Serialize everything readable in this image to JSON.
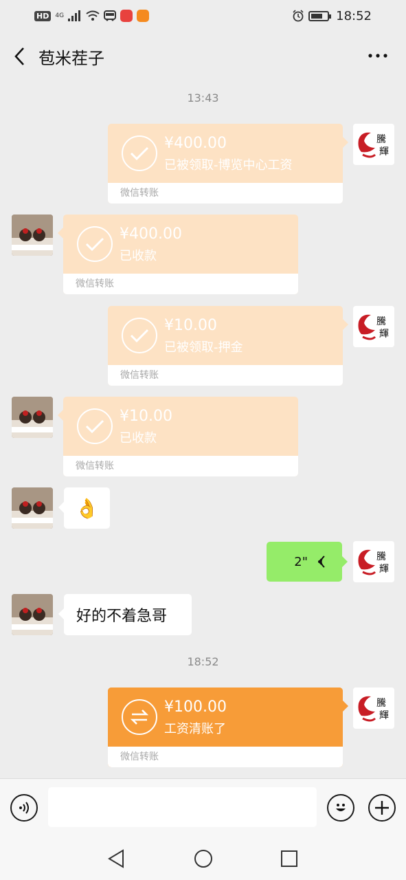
{
  "status_bar": {
    "hd": "HD",
    "network": "4G",
    "time": "18:52"
  },
  "header": {
    "back_icon": "chevron-left-icon",
    "title": "苞米茬子",
    "more_icon": "more-icon"
  },
  "self_avatar_text": [
    "騰",
    "輝"
  ],
  "messages": [
    {
      "type": "time",
      "text": "13:43"
    },
    {
      "type": "transfer",
      "side": "self",
      "amount": "¥400.00",
      "desc": "已被领取-博览中心工资",
      "footer": "微信转账",
      "icon": "check-icon"
    },
    {
      "type": "transfer",
      "side": "other",
      "amount": "¥400.00",
      "desc": "已收款",
      "footer": "微信转账",
      "icon": "check-icon"
    },
    {
      "type": "transfer",
      "side": "self",
      "amount": "¥10.00",
      "desc": "已被领取-押金",
      "footer": "微信转账",
      "icon": "check-icon"
    },
    {
      "type": "transfer",
      "side": "other",
      "amount": "¥10.00",
      "desc": "已收款",
      "footer": "微信转账",
      "icon": "check-icon"
    },
    {
      "type": "emoji",
      "side": "other",
      "emoji": "👌"
    },
    {
      "type": "voice",
      "side": "self",
      "duration": "2\""
    },
    {
      "type": "text",
      "side": "other",
      "text": "好的不着急哥"
    },
    {
      "type": "time",
      "text": "18:52"
    },
    {
      "type": "transfer",
      "side": "self",
      "amount": "¥100.00",
      "desc": "工资清账了",
      "footer": "微信转账",
      "icon": "transfer-arrows-icon",
      "pending": true
    }
  ],
  "input_bar": {
    "voice_icon": "voice-icon",
    "emoji_icon": "emoji-icon",
    "plus_icon": "plus-icon",
    "placeholder": ""
  },
  "colors": {
    "background": "#ededed",
    "transfer_done": "#fde2c4",
    "transfer_pending": "#f79c38",
    "voice_bubble": "#95ec69"
  }
}
